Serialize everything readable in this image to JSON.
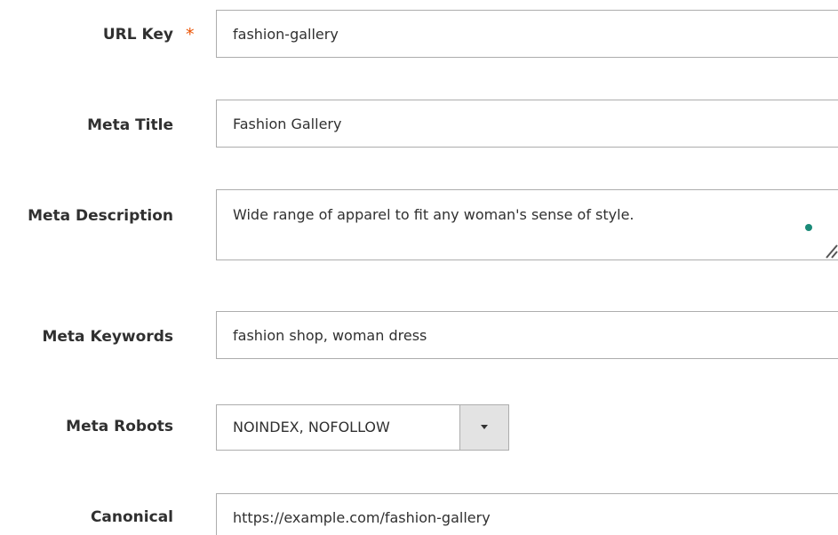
{
  "fields": {
    "url_key": {
      "label": "URL Key",
      "required_mark": "*",
      "value": "fashion-gallery"
    },
    "meta_title": {
      "label": "Meta Title",
      "value": "Fashion Gallery"
    },
    "meta_description": {
      "label": "Meta Description",
      "value": "Wide range of apparel to fit any woman's sense of style."
    },
    "meta_keywords": {
      "label": "Meta Keywords",
      "value": "fashion shop, woman dress"
    },
    "meta_robots": {
      "label": "Meta Robots",
      "selected": "NOINDEX, NOFOLLOW"
    },
    "canonical": {
      "label": "Canonical",
      "value": "https://example.com/fashion-gallery"
    }
  },
  "colors": {
    "required": "#eb5202",
    "status_dot": "#1a8a78",
    "border": "#adadad",
    "text": "#303030"
  },
  "icons": {
    "required": "asterisk",
    "dropdown": "triangle-down-icon",
    "resize": "resize-handle-icon",
    "status": "status-dot-icon"
  }
}
